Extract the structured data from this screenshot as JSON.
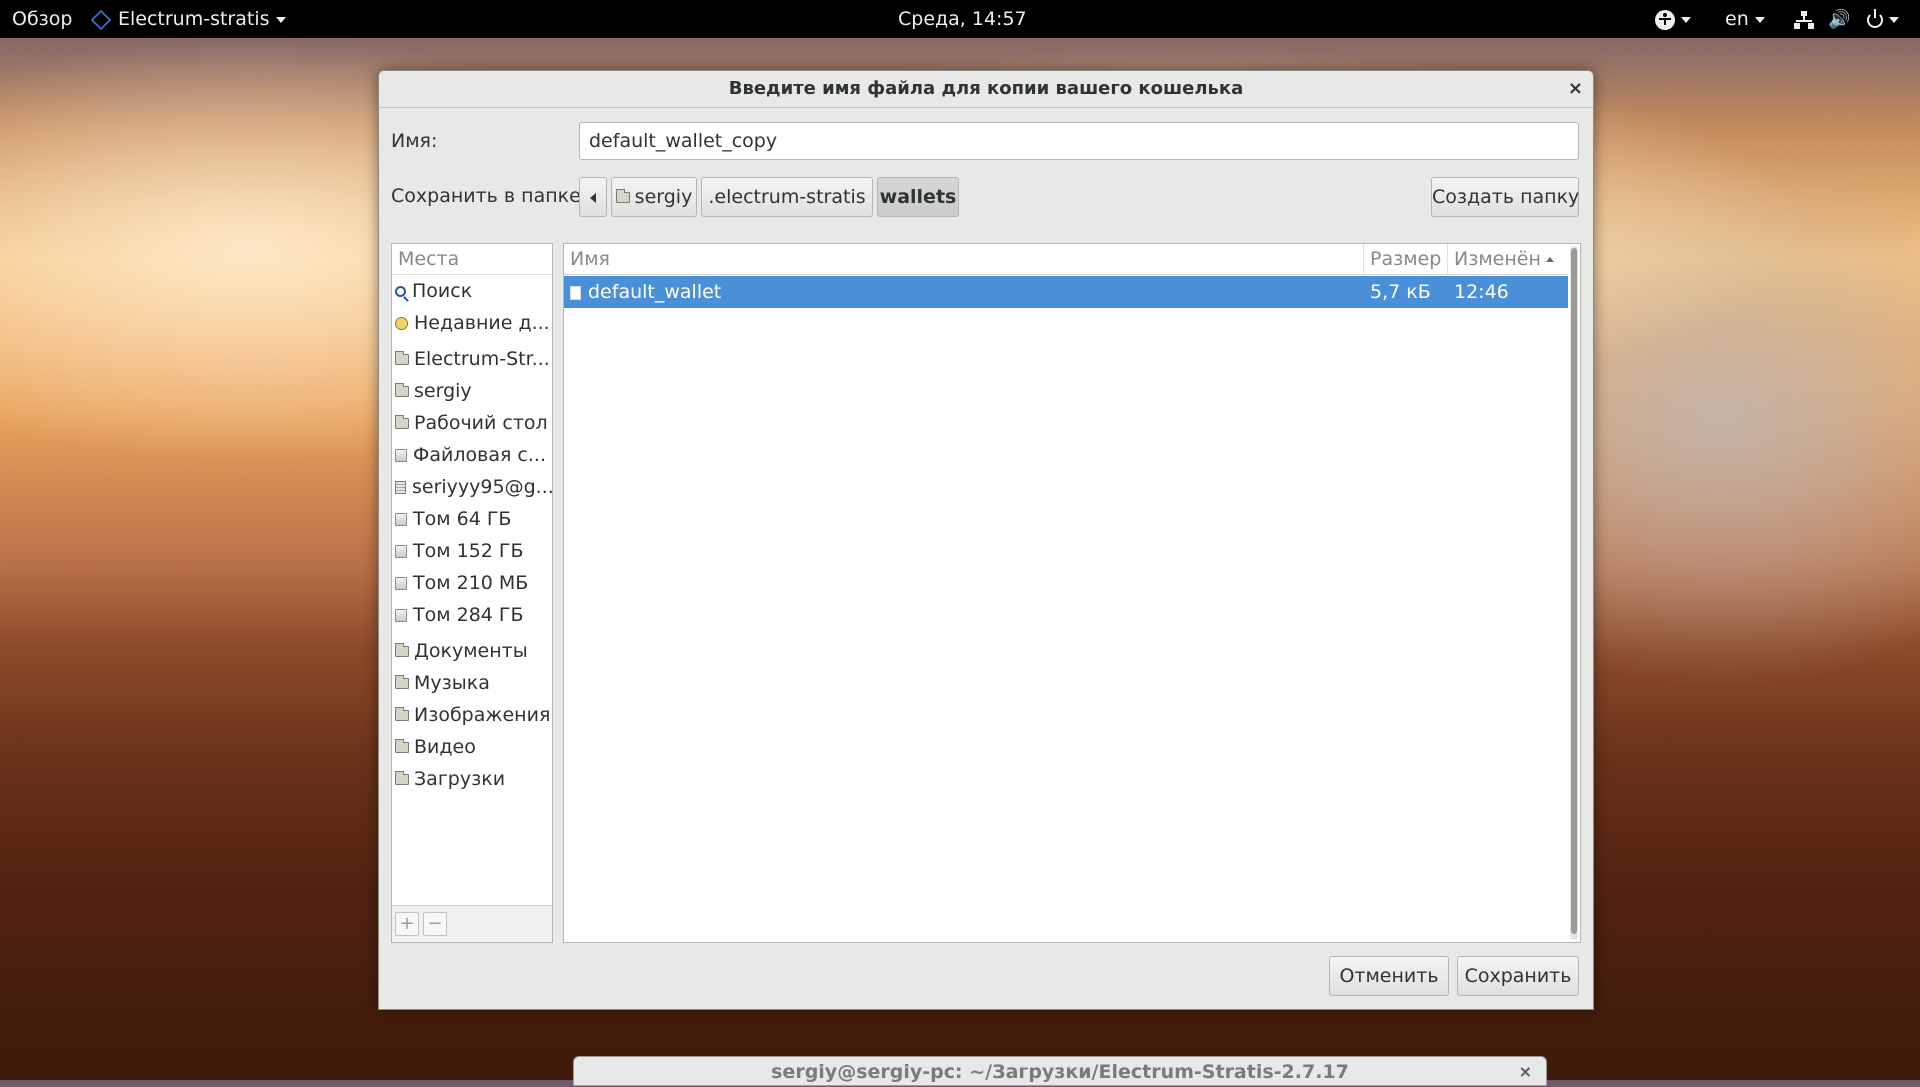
{
  "topbar": {
    "activities": "Обзор",
    "app_name": "Electrum-stratis",
    "clock": "Среда, 14:57",
    "keyboard_layout": "en",
    "icons": [
      "accessibility-icon",
      "network-icon",
      "volume-icon",
      "power-icon"
    ]
  },
  "dialog": {
    "title": "Введите имя файла для копии вашего кошелька",
    "close": "×",
    "name_label": "Имя:",
    "name_value": "default_wallet_copy",
    "save_in_label": "Сохранить в папке",
    "path": [
      "sergiy",
      ".electrum-stratis",
      "wallets"
    ],
    "create_folder": "Создать папку",
    "cancel": "Отменить",
    "save": "Сохранить"
  },
  "places": {
    "header": "Места",
    "items": [
      {
        "label": "Поиск",
        "icon": "search-icon"
      },
      {
        "label": "Недавние д...",
        "icon": "recent-icon"
      },
      {
        "label": "Electrum-Str...",
        "icon": "folder-icon"
      },
      {
        "label": "sergiy",
        "icon": "home-folder-icon"
      },
      {
        "label": "Рабочий стол",
        "icon": "desktop-folder-icon"
      },
      {
        "label": "Файловая с...",
        "icon": "filesystem-icon"
      },
      {
        "label": "seriyyy95@g...",
        "icon": "network-drive-icon"
      },
      {
        "label": "Том 64 ГБ",
        "icon": "drive-icon"
      },
      {
        "label": "Том 152 ГБ",
        "icon": "drive-icon"
      },
      {
        "label": "Том 210 МБ",
        "icon": "drive-icon"
      },
      {
        "label": "Том 284 ГБ",
        "icon": "drive-icon"
      },
      {
        "label": "Документы",
        "icon": "documents-folder-icon"
      },
      {
        "label": "Музыка",
        "icon": "music-folder-icon"
      },
      {
        "label": "Изображения",
        "icon": "pictures-folder-icon"
      },
      {
        "label": "Видео",
        "icon": "videos-folder-icon"
      },
      {
        "label": "Загрузки",
        "icon": "downloads-folder-icon"
      }
    ],
    "add": "+",
    "remove": "−"
  },
  "filelist": {
    "columns": [
      "Имя",
      "Размер",
      "Изменён"
    ],
    "rows": [
      {
        "name": "default_wallet",
        "size": "5,7 кБ",
        "modified": "12:46",
        "selected": true
      }
    ]
  },
  "terminal": {
    "title": "sergiy@sergiy-pc: ~/Загрузки/Electrum-Stratis-2.7.17",
    "close": "×"
  }
}
